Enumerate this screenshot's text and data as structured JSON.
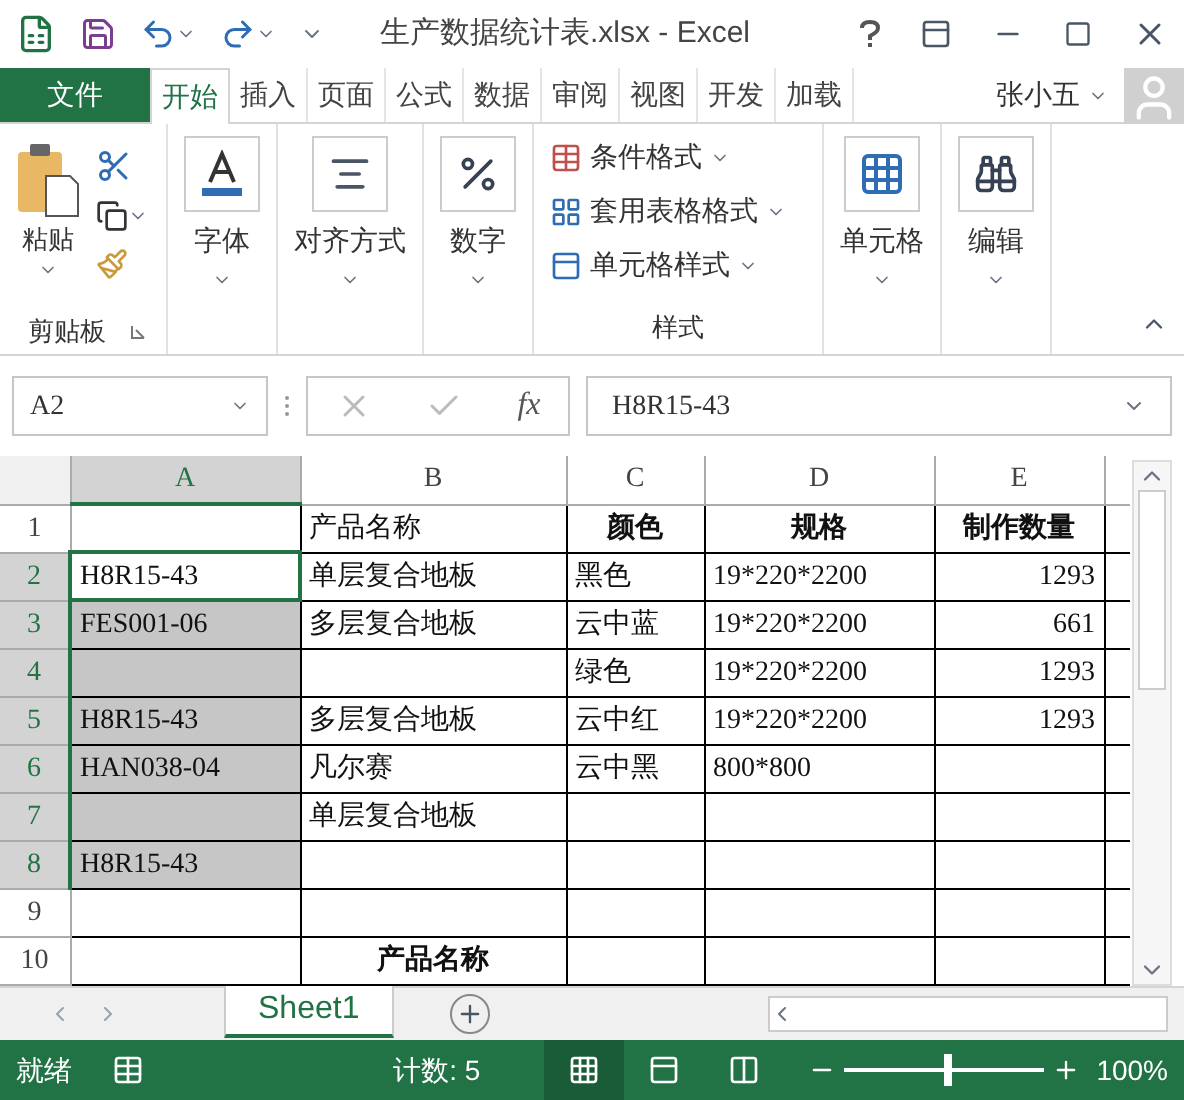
{
  "window": {
    "title": "生产数据统计表.xlsx - Excel"
  },
  "file_tab": "文件",
  "tabs": [
    {
      "label": "开始",
      "selected": true
    },
    {
      "label": "插入",
      "selected": false
    },
    {
      "label": "页面",
      "selected": false
    },
    {
      "label": "公式",
      "selected": false
    },
    {
      "label": "数据",
      "selected": false
    },
    {
      "label": "审阅",
      "selected": false
    },
    {
      "label": "视图",
      "selected": false
    },
    {
      "label": "开发",
      "selected": false
    },
    {
      "label": "加载",
      "selected": false
    }
  ],
  "user": "张小五",
  "ribbon": {
    "clipboard": {
      "paste": "粘贴",
      "label": "剪贴板"
    },
    "big_buttons": [
      {
        "kind": "font",
        "label": "字体"
      },
      {
        "kind": "align",
        "label": "对齐方式"
      },
      {
        "kind": "number",
        "label": "数字"
      }
    ],
    "styles": {
      "items": [
        {
          "kind": "conditional",
          "label": "条件格式"
        },
        {
          "kind": "table",
          "label": "套用表格格式"
        },
        {
          "kind": "cell",
          "label": "单元格样式"
        }
      ],
      "label": "样式"
    },
    "end_buttons": [
      {
        "kind": "cells",
        "label": "单元格"
      },
      {
        "kind": "edit",
        "label": "编辑"
      }
    ]
  },
  "name_box": "A2",
  "formula_bar": {
    "function_label": "fx",
    "value": "H8R15-43"
  },
  "columns": [
    {
      "label": "A",
      "selected": true
    },
    {
      "label": "B",
      "selected": false
    },
    {
      "label": "C",
      "selected": false
    },
    {
      "label": "D",
      "selected": false
    },
    {
      "label": "E",
      "selected": false
    }
  ],
  "rows": [
    {
      "label": "1",
      "selected": false,
      "cells": [
        {
          "kind": "text",
          "text": ""
        },
        {
          "kind": "text",
          "text": "产品名称"
        },
        {
          "kind": "heading",
          "text": "颜色"
        },
        {
          "kind": "heading",
          "text": "规格"
        },
        {
          "kind": "heading",
          "text": "制作数量"
        }
      ]
    },
    {
      "label": "2",
      "selected": true,
      "cells": [
        {
          "kind": "text",
          "text": "H8R15-43",
          "active": true
        },
        {
          "kind": "text",
          "text": "单层复合地板"
        },
        {
          "kind": "text",
          "text": "黑色"
        },
        {
          "kind": "text",
          "text": "19*220*2200"
        },
        {
          "kind": "number",
          "text": "1293"
        }
      ]
    },
    {
      "label": "3",
      "selected": true,
      "cells": [
        {
          "kind": "text",
          "text": "FES001-06"
        },
        {
          "kind": "text",
          "text": "多层复合地板"
        },
        {
          "kind": "text",
          "text": "云中蓝"
        },
        {
          "kind": "text",
          "text": "19*220*2200"
        },
        {
          "kind": "number",
          "text": "661"
        }
      ]
    },
    {
      "label": "4",
      "selected": true,
      "cells": [
        {
          "kind": "text",
          "text": ""
        },
        {
          "kind": "text",
          "text": ""
        },
        {
          "kind": "text",
          "text": "绿色"
        },
        {
          "kind": "text",
          "text": "19*220*2200"
        },
        {
          "kind": "number",
          "text": "1293"
        }
      ]
    },
    {
      "label": "5",
      "selected": true,
      "cells": [
        {
          "kind": "text",
          "text": "H8R15-43"
        },
        {
          "kind": "text",
          "text": "多层复合地板"
        },
        {
          "kind": "text",
          "text": "云中红"
        },
        {
          "kind": "text",
          "text": "19*220*2200"
        },
        {
          "kind": "number",
          "text": "1293"
        }
      ]
    },
    {
      "label": "6",
      "selected": true,
      "cells": [
        {
          "kind": "text",
          "text": "HAN038-04"
        },
        {
          "kind": "text",
          "text": "凡尔赛"
        },
        {
          "kind": "text",
          "text": "云中黑"
        },
        {
          "kind": "text",
          "text": "800*800"
        },
        {
          "kind": "number",
          "text": ""
        }
      ]
    },
    {
      "label": "7",
      "selected": true,
      "cells": [
        {
          "kind": "text",
          "text": ""
        },
        {
          "kind": "text",
          "text": "单层复合地板"
        },
        {
          "kind": "text",
          "text": ""
        },
        {
          "kind": "text",
          "text": ""
        },
        {
          "kind": "number",
          "text": ""
        }
      ]
    },
    {
      "label": "8",
      "selected": true,
      "cells": [
        {
          "kind": "text",
          "text": "H8R15-43"
        },
        {
          "kind": "text",
          "text": ""
        },
        {
          "kind": "text",
          "text": ""
        },
        {
          "kind": "text",
          "text": ""
        },
        {
          "kind": "number",
          "text": ""
        }
      ]
    },
    {
      "label": "9",
      "selected": false,
      "cells": [
        {
          "kind": "text",
          "text": ""
        },
        {
          "kind": "text",
          "text": ""
        },
        {
          "kind": "text",
          "text": ""
        },
        {
          "kind": "text",
          "text": ""
        },
        {
          "kind": "number",
          "text": ""
        }
      ]
    },
    {
      "label": "10",
      "selected": false,
      "cells": [
        {
          "kind": "text",
          "text": ""
        },
        {
          "kind": "heading",
          "text": "产品名称"
        },
        {
          "kind": "text",
          "text": ""
        },
        {
          "kind": "text",
          "text": ""
        },
        {
          "kind": "number",
          "text": ""
        }
      ]
    }
  ],
  "sheet_tabs": [
    {
      "label": "Sheet1",
      "selected": true
    }
  ],
  "status_bar": {
    "state": "就绪",
    "count": "计数: 5",
    "views": [
      {
        "kind": "normal",
        "selected": true
      },
      {
        "kind": "layout",
        "selected": false
      },
      {
        "kind": "break",
        "selected": false
      }
    ],
    "zoom": {
      "level": 0.5,
      "reading": "100%"
    }
  }
}
